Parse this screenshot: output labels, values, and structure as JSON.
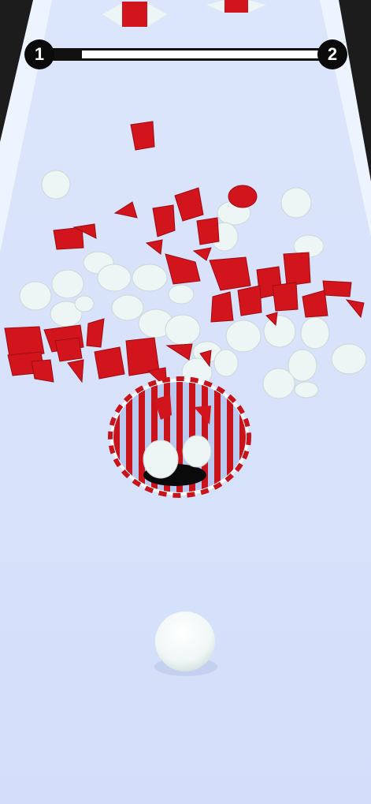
{
  "hud": {
    "current_level": "1",
    "next_level": "2",
    "level_progress": 0.14
  },
  "colors": {
    "background": "#1e1e1e",
    "track": "#d6e2fb",
    "track_edge": "#eef4ff",
    "piece_red": "#d2141c",
    "piece_white": "#eef5f5",
    "hole_stripe_red": "#c8131b",
    "hole_stripe_light": "#b9c8ee",
    "player_ball": "#f4f8f8",
    "progress_bar": "#111111",
    "progress_track": "#ffffff"
  },
  "icons": {
    "current_level_badge": "level-circle-badge",
    "next_level_badge": "level-circle-badge"
  }
}
